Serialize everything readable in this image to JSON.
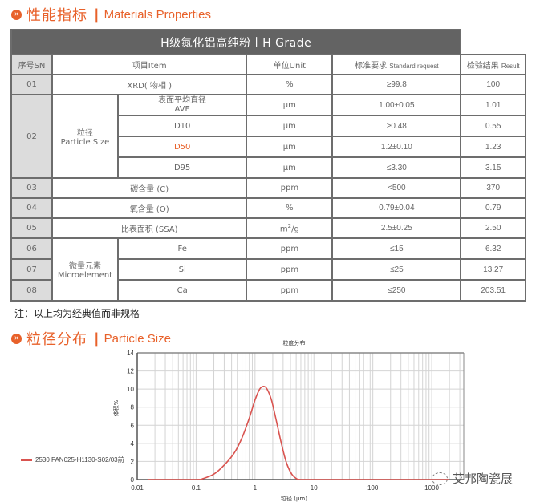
{
  "section1": {
    "icon": "logo-badge-icon",
    "title_zh": "性能指标",
    "separator": "|",
    "title_en": "Materials Properties"
  },
  "table": {
    "grade_title": "H级氮化铝高纯粉丨H Grade",
    "headers": {
      "sn": "序号SN",
      "item": "项目Item",
      "unit": "单位Unit",
      "standard_zh": "标准要求",
      "standard_en": "Standard request",
      "result_zh": "检验结果",
      "result_en": "Result"
    },
    "rows": [
      {
        "sn": "01",
        "item": "XRD( 物相 )",
        "unit": "%",
        "standard": "≥99.8",
        "result": "100"
      },
      {
        "sn": "02",
        "group": "粒径",
        "group_en": "Particle Size",
        "subrows": [
          {
            "item_zh": "表面平均直径",
            "item_en": "AVE",
            "unit": "μm",
            "standard": "1.00±0.05",
            "result": "1.01"
          },
          {
            "item": "D10",
            "unit": "μm",
            "standard": "≥0.48",
            "result": "0.55"
          },
          {
            "item": "D50",
            "unit": "μm",
            "standard": "1.2±0.10",
            "result": "1.23"
          },
          {
            "item": "D95",
            "unit": "μm",
            "standard": "≤3.30",
            "result": "3.15"
          }
        ]
      },
      {
        "sn": "03",
        "item": "碳含量 (C)",
        "unit": "ppm",
        "standard": "<500",
        "result": "370"
      },
      {
        "sn": "04",
        "item": "氧含量 (O)",
        "unit": "%",
        "standard": "0.79±0.04",
        "result": "0.79"
      },
      {
        "sn": "05",
        "item": "比表面积 (SSA)",
        "unit_base": "m",
        "unit_sup": "2",
        "unit_tail": "/g",
        "standard": "2.5±0.25",
        "result": "2.50"
      },
      {
        "sn": "06",
        "group": "微量元素",
        "group_en": "Microelement",
        "item": "Fe",
        "unit": "ppm",
        "standard": "≤15",
        "result": "6.32"
      },
      {
        "sn": "07",
        "item": "Si",
        "unit": "ppm",
        "standard": "≤25",
        "result": "13.27"
      },
      {
        "sn": "08",
        "item": "Ca",
        "unit": "ppm",
        "standard": "≤250",
        "result": "203.51"
      }
    ]
  },
  "note": "注：以上均为经典值而非规格",
  "section2": {
    "icon": "logo-badge-icon",
    "title_zh": "粒径分布",
    "separator": "|",
    "title_en": "Particle Size"
  },
  "watermark": {
    "icon": "wechat-icon",
    "text": "艾邦陶瓷展"
  },
  "colors": {
    "accent": "#e8612a",
    "header_bg": "#636363",
    "sn_bg": "#dcdcdc",
    "curve": "#d9534f"
  },
  "chart_data": {
    "type": "line",
    "title": "粒度分布",
    "xlabel": "粒径 (μm)",
    "ylabel": "体积%",
    "xscale": "log",
    "xlim": [
      0.01,
      3500
    ],
    "ylim": [
      0,
      14
    ],
    "xticks": [
      "0.01",
      "0.1",
      "1",
      "10",
      "100",
      "1000"
    ],
    "xtick_values": [
      0.01,
      0.1,
      1,
      10,
      100,
      1000
    ],
    "yticks": [
      "0",
      "2",
      "4",
      "6",
      "8",
      "10",
      "12",
      "14"
    ],
    "ytick_values": [
      0,
      2,
      4,
      6,
      8,
      10,
      12,
      14
    ],
    "grid": true,
    "legend": "left",
    "series": [
      {
        "name": "2530 FAN025-H1130-S02/03前",
        "x": [
          0.015,
          0.1,
          0.13,
          0.2,
          0.3,
          0.45,
          0.6,
          0.8,
          1.0,
          1.2,
          1.4,
          1.6,
          1.9,
          2.3,
          2.8,
          3.4,
          4.2,
          5.2,
          6.0,
          10,
          100,
          1000,
          2000
        ],
        "y": [
          0,
          0,
          0.1,
          0.6,
          1.6,
          3.0,
          4.6,
          6.8,
          8.8,
          10.0,
          10.3,
          10.0,
          8.8,
          6.5,
          4.0,
          1.9,
          0.6,
          0.05,
          0,
          0,
          0,
          0,
          0
        ]
      }
    ]
  }
}
